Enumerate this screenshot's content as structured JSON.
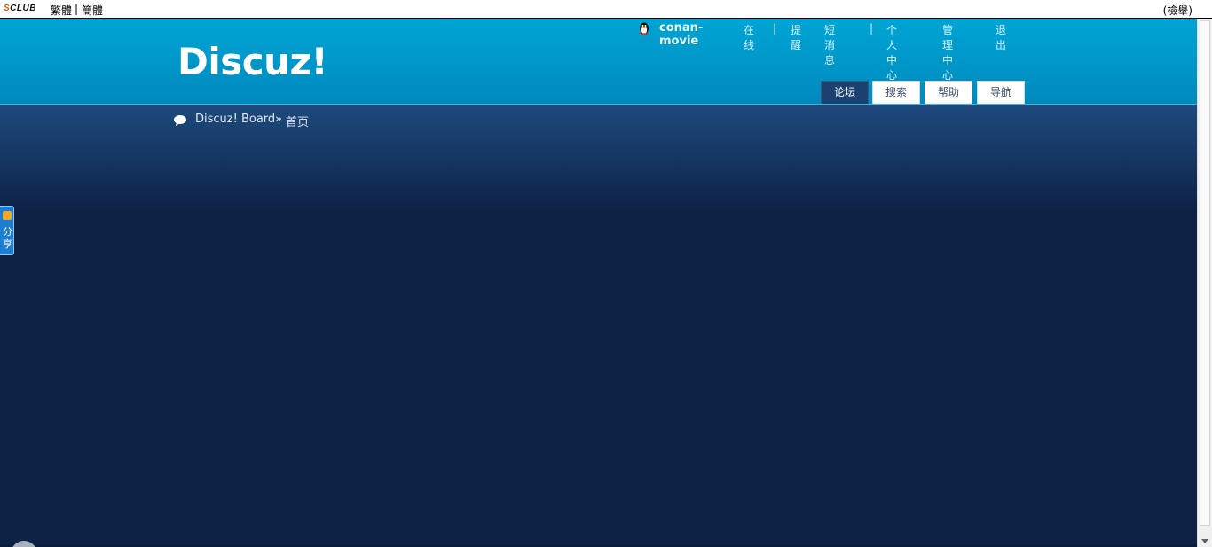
{
  "topbar": {
    "brand": "SCLUB",
    "brand_s": "S",
    "brand_rest": "CLUB",
    "traditional": "繁體",
    "separator": "|",
    "simplified": "簡體",
    "right_text": "(檢舉)"
  },
  "header": {
    "logo": "Discuz!",
    "user": {
      "username": "conan-movie",
      "status": "在线",
      "links": [
        "提醒",
        "短消息",
        "个人中心",
        "管理中心",
        "退出"
      ],
      "separator": "|"
    },
    "tabs": [
      {
        "label": "论坛",
        "active": true
      },
      {
        "label": "搜索",
        "active": false
      },
      {
        "label": "帮助",
        "active": false
      },
      {
        "label": "导航",
        "active": false
      }
    ]
  },
  "breadcrumb": {
    "home": "Discuz! Board",
    "separator": "»",
    "current": "首页"
  },
  "share": {
    "label_1": "分",
    "label_2": "享"
  },
  "colors": {
    "header_blue": "#00a5d4",
    "content_navy": "#0e2246",
    "active_tab": "#1a416f",
    "share_blue": "#1b7ed0"
  },
  "icons": {
    "user": "qq-penguin-icon",
    "breadcrumb": "speech-bubble-icon",
    "share": "share-logo-icon"
  }
}
